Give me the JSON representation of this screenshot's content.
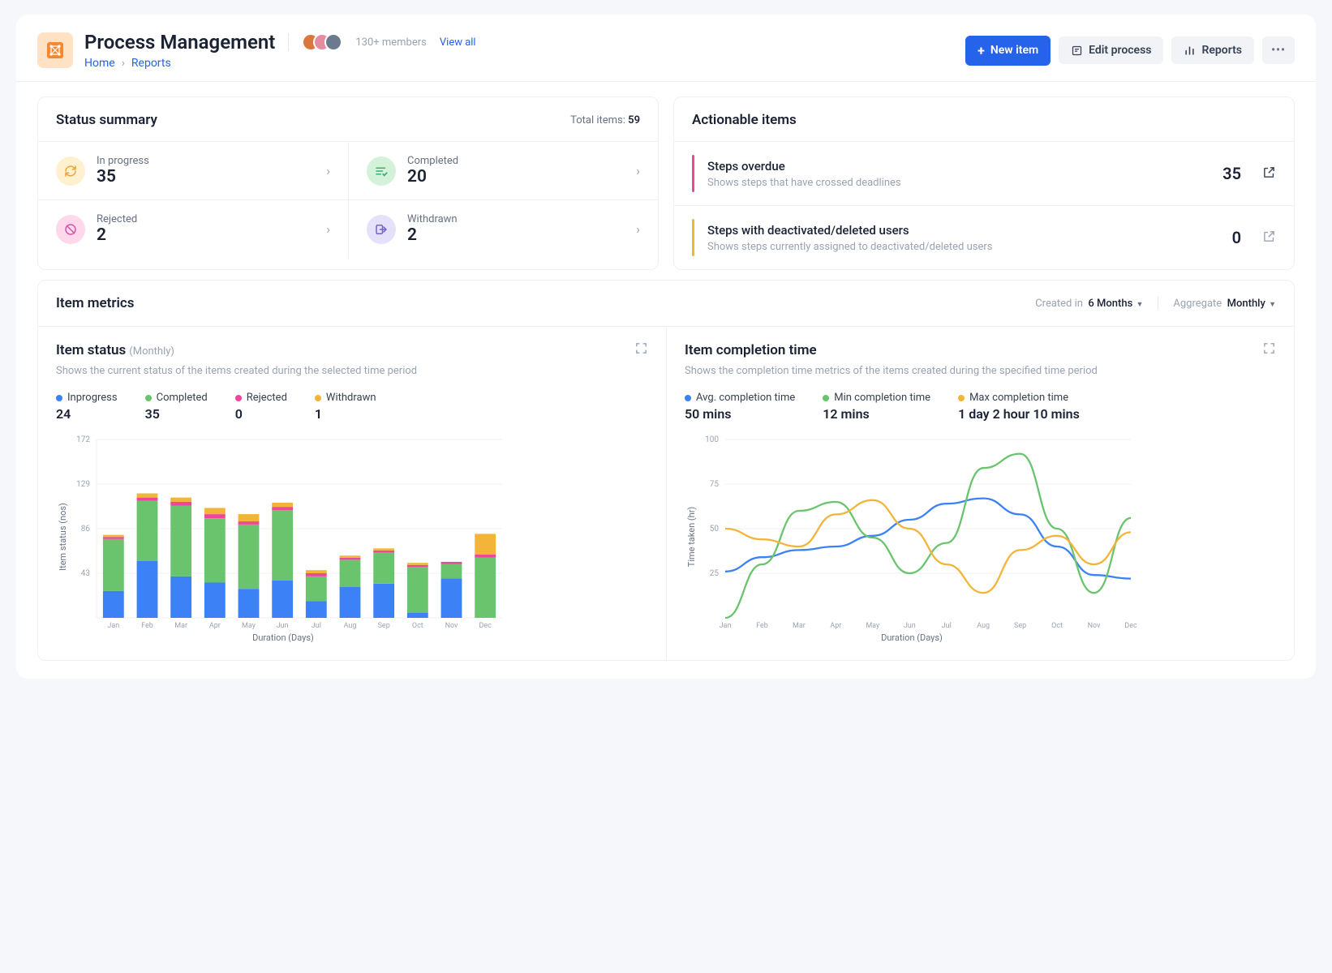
{
  "header": {
    "title": "Process Management",
    "members_label": "130+ members",
    "viewall": "View all",
    "breadcrumb": [
      "Home",
      "Reports"
    ],
    "avatar_colors": [
      "#d9773c",
      "#e78ba0",
      "#6b7a8f"
    ]
  },
  "buttons": {
    "new_item": "New item",
    "edit_process": "Edit process",
    "reports": "Reports"
  },
  "status_summary": {
    "title": "Status summary",
    "total_label": "Total items:",
    "total_value": "59",
    "items": [
      {
        "label": "In progress",
        "value": "35",
        "icon": "refresh",
        "bg": "#fff1cf",
        "fg": "#e9a43b"
      },
      {
        "label": "Completed",
        "value": "20",
        "icon": "check",
        "bg": "#d4f2d9",
        "fg": "#3cb371"
      },
      {
        "label": "Rejected",
        "value": "2",
        "icon": "ban",
        "bg": "#ffd8ec",
        "fg": "#d157a8"
      },
      {
        "label": "Withdrawn",
        "value": "2",
        "icon": "exit",
        "bg": "#e5e1fb",
        "fg": "#6f63d6"
      }
    ]
  },
  "actionable": {
    "title": "Actionable items",
    "items": [
      {
        "title": "Steps overdue",
        "desc": "Shows steps that have crossed deadlines",
        "value": "35",
        "bar": "#ec4899",
        "link_enabled": true
      },
      {
        "title": "Steps with deactivated/deleted users",
        "desc": "Shows steps currently assigned to deactivated/deleted users",
        "value": "0",
        "bar": "#f2b53a",
        "link_enabled": false
      }
    ]
  },
  "metrics": {
    "title": "Item metrics",
    "created_in_label": "Created in",
    "created_in_value": "6 Months",
    "aggregate_label": "Aggregate",
    "aggregate_value": "Monthly"
  },
  "item_status": {
    "title": "Item status",
    "subtitle": "(Monthly)",
    "desc": "Shows the current status of the items created during the selected time period",
    "legend": [
      {
        "label": "Inprogress",
        "value": "24",
        "color": "#3c82f6"
      },
      {
        "label": "Completed",
        "value": "35",
        "color": "#6ac46e"
      },
      {
        "label": "Rejected",
        "value": "0",
        "color": "#ec4899"
      },
      {
        "label": "Withdrawn",
        "value": "1",
        "color": "#f2b53a"
      }
    ],
    "xlabel": "Duration (Days)",
    "ylabel": "Item status (nos)"
  },
  "completion": {
    "title": "Item completion time",
    "desc": "Shows the completion time metrics of the items created during the specified time period",
    "legend": [
      {
        "label": "Avg. completion time",
        "value": "50 mins",
        "color": "#3c82f6"
      },
      {
        "label": "Min completion time",
        "value": "12 mins",
        "color": "#6ac46e"
      },
      {
        "label": "Max completion time",
        "value": "1 day 2 hour 10 mins",
        "color": "#f2b53a"
      }
    ],
    "xlabel": "Duration (Days)",
    "ylabel": "Time taken (hr)"
  },
  "chart_data": [
    {
      "type": "bar",
      "title": "Item status (Monthly)",
      "xlabel": "Duration (Days)",
      "ylabel": "Item status (nos)",
      "ylim": [
        0,
        172
      ],
      "yticks": [
        43,
        86,
        129,
        172
      ],
      "categories": [
        "Jan",
        "Feb",
        "Mar",
        "Apr",
        "May",
        "Jun",
        "Jul",
        "Aug",
        "Sep",
        "Oct",
        "Nov",
        "Dec"
      ],
      "series": [
        {
          "name": "Inprogress",
          "color": "#3c82f6",
          "values": [
            26,
            55,
            40,
            34,
            28,
            36,
            16,
            30,
            33,
            5,
            38,
            0
          ]
        },
        {
          "name": "Completed",
          "color": "#6ac46e",
          "values": [
            50,
            58,
            68,
            62,
            62,
            68,
            24,
            26,
            30,
            44,
            14,
            58
          ]
        },
        {
          "name": "Rejected",
          "color": "#ec4899",
          "values": [
            2,
            3,
            4,
            4,
            3,
            3,
            3,
            2,
            2,
            2,
            2,
            3
          ]
        },
        {
          "name": "Withdrawn",
          "color": "#f2b53a",
          "values": [
            2,
            4,
            4,
            6,
            7,
            4,
            3,
            2,
            2,
            2,
            0,
            20
          ]
        }
      ]
    },
    {
      "type": "line",
      "title": "Item completion time",
      "xlabel": "Duration (Days)",
      "ylabel": "Time taken (hr)",
      "ylim": [
        0,
        100
      ],
      "yticks": [
        25,
        50,
        75,
        100
      ],
      "categories": [
        "Jan",
        "Feb",
        "Mar",
        "Apr",
        "May",
        "Jun",
        "Jul",
        "Aug",
        "Sep",
        "Oct",
        "Nov",
        "Dec"
      ],
      "series": [
        {
          "name": "Avg. completion time",
          "color": "#3c82f6",
          "values": [
            26,
            34,
            38,
            40,
            46,
            55,
            64,
            67,
            58,
            40,
            24,
            22
          ]
        },
        {
          "name": "Min completion time",
          "color": "#6ac46e",
          "values": [
            0,
            30,
            60,
            65,
            45,
            25,
            42,
            84,
            92,
            50,
            14,
            56
          ]
        },
        {
          "name": "Max completion time",
          "color": "#f2b53a",
          "values": [
            50,
            44,
            40,
            58,
            66,
            50,
            30,
            14,
            38,
            46,
            30,
            48
          ]
        }
      ]
    }
  ]
}
